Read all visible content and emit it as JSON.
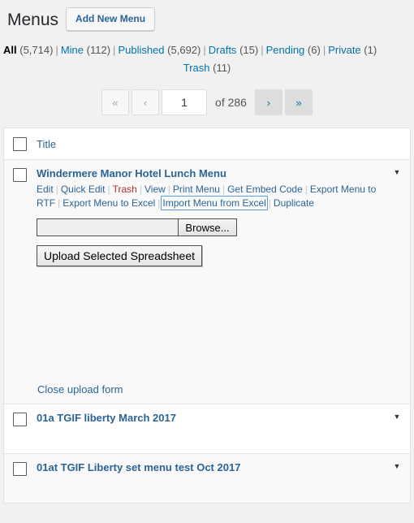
{
  "header": {
    "title": "Menus",
    "add_new_label": "Add New Menu"
  },
  "filters": [
    {
      "label": "All",
      "count": "(5,714)",
      "current": true
    },
    {
      "label": "Mine",
      "count": "(112)",
      "current": false
    },
    {
      "label": "Published",
      "count": "(5,692)",
      "current": false
    },
    {
      "label": "Drafts",
      "count": "(15)",
      "current": false
    },
    {
      "label": "Pending",
      "count": "(6)",
      "current": false
    },
    {
      "label": "Private",
      "count": "(1)",
      "current": false
    },
    {
      "label": "Trash",
      "count": "(11)",
      "current": false
    }
  ],
  "filter_separator": "|",
  "pagination": {
    "first_icon": "«",
    "prev_icon": "‹",
    "current_page": "1",
    "total_label": "of 286",
    "total_pages": 286,
    "next_icon": "›",
    "last_icon": "»",
    "first_enabled": false,
    "prev_enabled": false,
    "next_enabled": true,
    "last_enabled": true
  },
  "table": {
    "column_header_title": "Title",
    "toggle_icon": "▼",
    "rows": [
      {
        "title": "Windermere Manor Hotel Lunch Menu",
        "expanded": true,
        "actions": [
          "Edit",
          "Quick Edit",
          "Trash",
          "View",
          "Print Menu",
          "Get Embed Code",
          "Export Menu to RTF",
          "Export Menu to Excel",
          "Import Menu from Excel",
          "Duplicate"
        ]
      },
      {
        "title": "01a TGIF liberty March 2017",
        "expanded": false
      },
      {
        "title": "01at TGIF Liberty set menu test Oct 2017",
        "expanded": false
      }
    ],
    "action_separator": "|"
  },
  "upload_form": {
    "file_field_value": "",
    "browse_label": "Browse...",
    "upload_label": "Upload Selected Spreadsheet",
    "close_label": "Close upload form"
  },
  "colors": {
    "link": "#2a6496",
    "link_alt": "#0073aa",
    "trash": "#b32d2e",
    "page_bg": "#f1f1f1",
    "row_alt_bg": "#f9f9f9",
    "border": "#e1e1e1",
    "focus_outline": "#5b9dd9"
  }
}
